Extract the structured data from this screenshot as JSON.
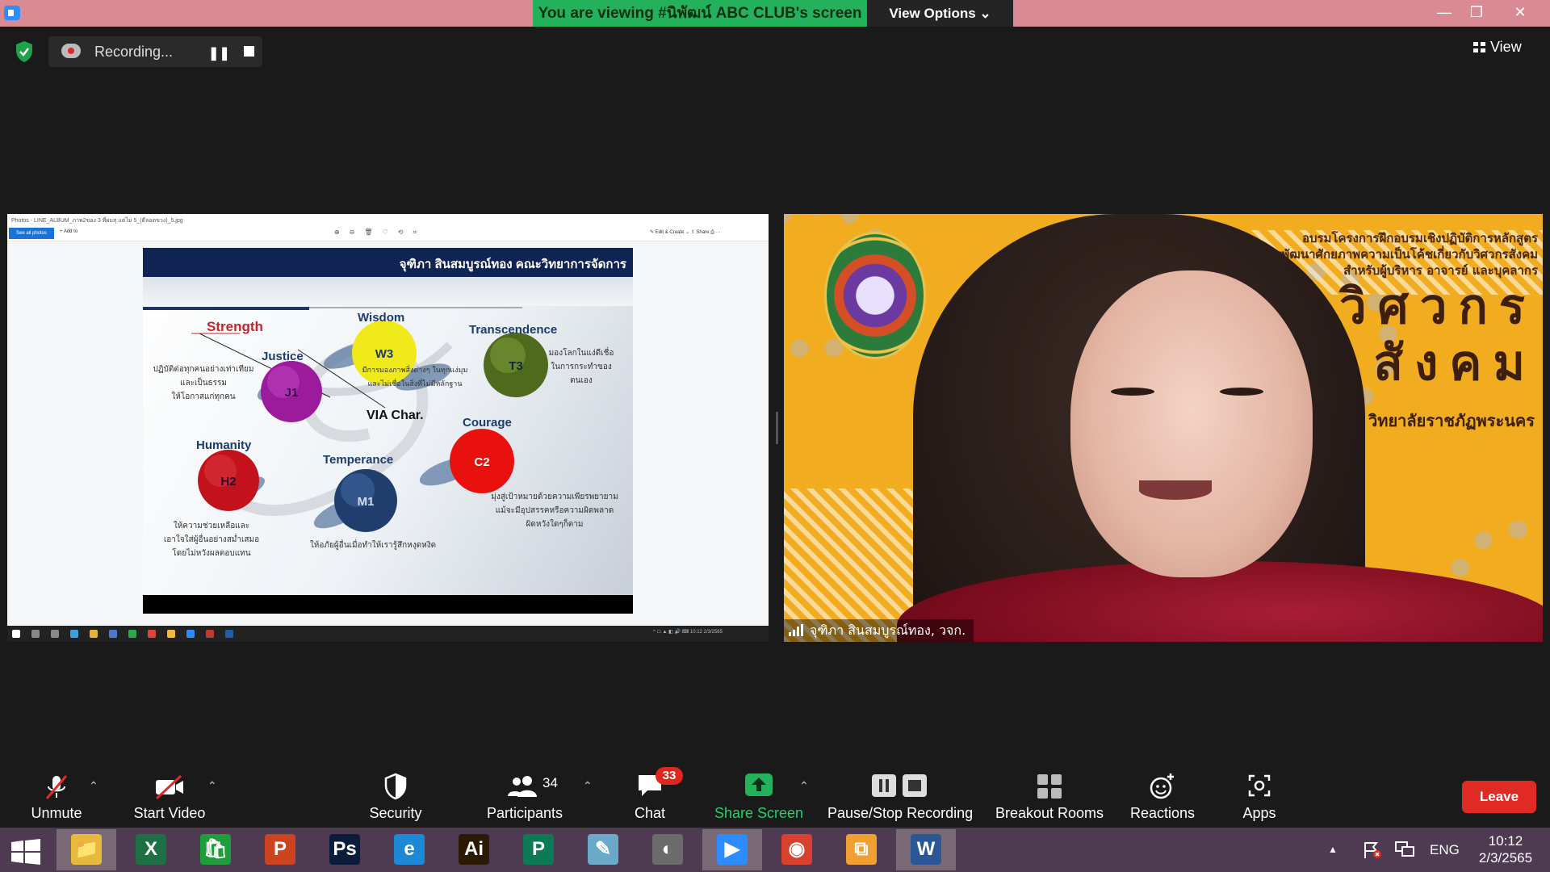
{
  "window": {
    "banner_text": "You are viewing #นิพัฒน์ ABC CLUB's screen",
    "view_options_label": "View Options ⌄",
    "minimize": "—",
    "restore": "❐",
    "close": "✕"
  },
  "recording": {
    "label": "Recording...",
    "pause_glyph": "❚❚",
    "view_label": "View"
  },
  "shared_screen": {
    "photos_title": "Photos - LINE_ALBUM_ภาพ2ของ 3 ที่ผมสุ แต่ไม่ 5_(ดีลอดขวง)_5.jpg",
    "see_all": "See all photos",
    "add_to": "+ Add to",
    "toolbar_icons": "⊕⊖🗑♡⟲⌗",
    "toolbar_right": "✎ Edit & Create ⌄   ⇪ Share   ⎙   ···",
    "tray_text": "^ ☖ ▲ ◧ 🔊 ⌨   10:12 2/3/2565",
    "slide": {
      "header": "จุฑิภา สินสมบูรณ์ทอง คณะวิทยาการจัดการ",
      "center_label": "VIA Char.",
      "strength": "Strength",
      "virtues": [
        {
          "name": "Wisdom",
          "code": "W3",
          "color": "#f1ea1a",
          "text_color": "#1b3c6e"
        },
        {
          "name": "Transcendence",
          "code": "T3",
          "color": "#4d6a1d",
          "text_color": "#0f2a40"
        },
        {
          "name": "Justice",
          "code": "J1",
          "color": "#9c1b9d",
          "text_color": "#3a0a45"
        },
        {
          "name": "Courage",
          "code": "C2",
          "color": "#e8110e",
          "text_color": "#fff"
        },
        {
          "name": "Humanity",
          "code": "H2",
          "color": "#c4121c",
          "text_color": "#2b0a35"
        },
        {
          "name": "Temperance",
          "code": "M1",
          "color": "#1f3e6e",
          "text_color": "#d0dcf0"
        }
      ],
      "desc_justice": [
        "ปฏิบัติต่อทุกคนอย่างเท่าเทียม",
        "และเป็นธรรม",
        "ให้โอกาสแก่ทุกคน"
      ],
      "desc_wisdom": [
        "มีการมองภาพสิ่งต่างๆ ในทุกแง่มุม",
        "และไม่เชื่อในสิ่งที่ไม่มีหลักฐาน"
      ],
      "desc_transcendence": [
        "มองโลกในแง่ดีเชื่อ",
        "ในการกระทำของ",
        "ตนเอง"
      ],
      "desc_courage": [
        "มุ่งสู่เป้าหมายด้วยความเพียรพยายาม",
        "แม้จะมีอุปสรรคหรือความผิดพลาด",
        "ผิดหวังใดๆก็ตาม"
      ],
      "desc_humanity": [
        "ให้ความช่วยเหลือและ",
        "เอาใจใส่ผู้อื่นอย่างสม่ำเสมอ",
        "โดยไม่หวังผลตอบแทน"
      ],
      "desc_temperance": [
        "ให้อภัยผู้อื่นเมื่อทำให้เรารู้สึกหงุดหงิด"
      ]
    }
  },
  "video": {
    "banner_lines": [
      "อบรมโครงการฝึกอบรมเชิงปฏิบัติการหลักสูตร",
      "การพัฒนาศักยภาพความเป็นโค้ชเกี่ยวกับวิศวกรสังคม",
      "สำหรับผู้บริหาร อาจารย์ และบุคลากร"
    ],
    "big_text_line1": "วิศวกร",
    "big_text_line2": "สังคม",
    "university": "วิทยาลัยราชภัฏพระนคร",
    "participant_name": "จุฑิภา สินสมบูรณ์ทอง, วจก."
  },
  "controls": {
    "unmute": "Unmute",
    "start_video": "Start Video",
    "security": "Security",
    "participants": "Participants",
    "participants_count": "34",
    "chat": "Chat",
    "chat_badge": "33",
    "share_screen": "Share Screen",
    "pause_stop_recording": "Pause/Stop Recording",
    "breakout_rooms": "Breakout Rooms",
    "reactions": "Reactions",
    "apps": "Apps",
    "leave": "Leave",
    "caret": "⌃"
  },
  "taskbar": {
    "apps": [
      {
        "name": "file-explorer",
        "glyph": "📁",
        "bg": "#e7b93c",
        "active": true
      },
      {
        "name": "excel",
        "glyph": "X",
        "bg": "#1d7044"
      },
      {
        "name": "store",
        "glyph": "🛍",
        "bg": "#1f9d3a"
      },
      {
        "name": "powerpoint",
        "glyph": "P",
        "bg": "#c9441f"
      },
      {
        "name": "photoshop",
        "glyph": "Ps",
        "bg": "#0b1d3a"
      },
      {
        "name": "internet-explorer",
        "glyph": "e",
        "bg": "#1d88d6"
      },
      {
        "name": "illustrator",
        "glyph": "Ai",
        "bg": "#2d1a05"
      },
      {
        "name": "publisher",
        "glyph": "P",
        "bg": "#0e7a55"
      },
      {
        "name": "notepad",
        "glyph": "✎",
        "bg": "#6aa9c9"
      },
      {
        "name": "photoscape",
        "glyph": "◐",
        "bg": "#6b6b6b"
      },
      {
        "name": "zoom",
        "glyph": "▶",
        "bg": "#2d8cff",
        "active": true
      },
      {
        "name": "chrome",
        "glyph": "◉",
        "bg": "#d9412f"
      },
      {
        "name": "photos",
        "glyph": "⧉",
        "bg": "#f0a030"
      },
      {
        "name": "word",
        "glyph": "W",
        "bg": "#2b5797",
        "active": true
      }
    ],
    "tray_up": "▲",
    "language": "ENG",
    "time": "10:12",
    "date": "2/3/2565"
  }
}
